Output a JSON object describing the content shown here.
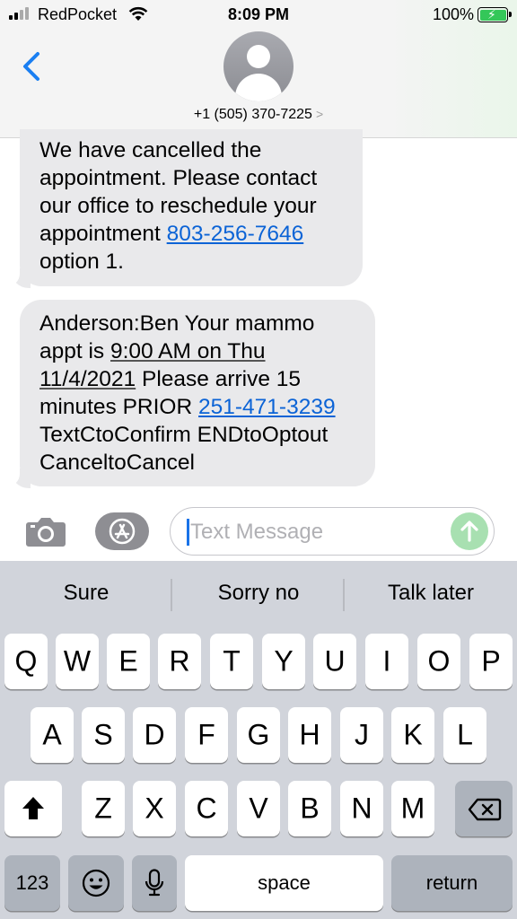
{
  "status_bar": {
    "carrier": "RedPocket",
    "time": "8:09 PM",
    "battery_percent": "100%",
    "icons": [
      "signal-icon",
      "wifi-icon",
      "battery-charging-icon"
    ]
  },
  "header": {
    "back_icon": "chevron-left-icon",
    "contact_number": "+1 (505) 370-7225",
    "avatar_icon": "person-icon"
  },
  "messages": [
    {
      "lines": [
        {
          "text": "We have cancelled the"
        },
        {
          "text": "appointment. Please contact"
        },
        {
          "text": "our office to reschedule your"
        },
        {
          "pre": "appointment ",
          "link": "803-256-7646"
        },
        {
          "text": "option 1."
        }
      ]
    },
    {
      "lines": [
        {
          "text": "Anderson:Ben Your mammo"
        },
        {
          "pre": "appt is ",
          "date": "9:00 AM on Thu"
        },
        {
          "date": "11/4/2021",
          "post": " Please arrive 15"
        },
        {
          "pre": "minutes PRIOR ",
          "link": "251-471-3239"
        },
        {
          "text": "TextCtoConfirm ENDtoOptout"
        },
        {
          "text": "CanceltoCancel"
        }
      ]
    }
  ],
  "compose": {
    "placeholder": "Text Message",
    "icons": [
      "camera-icon",
      "app-store-icon",
      "send-arrow-icon"
    ]
  },
  "keyboard": {
    "suggestions": [
      "Sure",
      "Sorry no",
      "Talk later"
    ],
    "row1": [
      "Q",
      "W",
      "E",
      "R",
      "T",
      "Y",
      "U",
      "I",
      "O",
      "P"
    ],
    "row2": [
      "A",
      "S",
      "D",
      "F",
      "G",
      "H",
      "J",
      "K",
      "L"
    ],
    "row3": [
      "Z",
      "X",
      "C",
      "V",
      "B",
      "N",
      "M"
    ],
    "numbers_label": "123",
    "space_label": "space",
    "return_label": "return",
    "special_icons": [
      "shift-icon",
      "backspace-icon",
      "emoji-icon",
      "microphone-icon"
    ]
  }
}
